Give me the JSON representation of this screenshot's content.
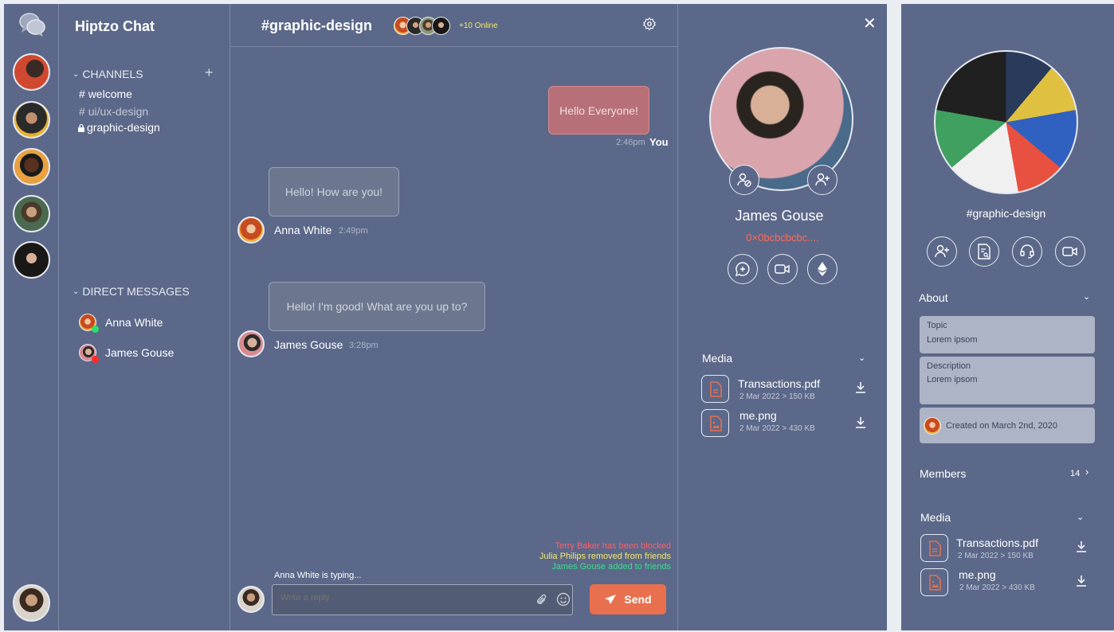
{
  "app_name": "Hiptzo Chat",
  "channels": {
    "header": "CHANNELS",
    "items": [
      {
        "prefix": "#",
        "label": "welcome"
      },
      {
        "prefix": "#",
        "label": "ui/ux-design"
      },
      {
        "prefix": "lock",
        "label": "graphic-design"
      }
    ]
  },
  "direct_messages": {
    "header": "DIRECT MESSAGES",
    "items": [
      {
        "label": "Anna White",
        "status_color": "#2ee06b"
      },
      {
        "label": "James Gouse",
        "status_color": "#ff2b2b"
      }
    ]
  },
  "chat": {
    "title": "#graphic-design",
    "online": "+10 Online",
    "messages": [
      {
        "text": "Hello Everyone!",
        "time": "2:46pm",
        "author": "You"
      },
      {
        "text": "Hello! How are you!",
        "author": "Anna White",
        "time": "2:49pm"
      },
      {
        "text": "Hello! I'm good! What are you up to?",
        "author": "James Gouse",
        "time": "3:28pm"
      }
    ],
    "notifications": [
      {
        "text": "Terry Baker has been blocked",
        "color": "#ff5f6b"
      },
      {
        "text": "Julia Philips removed from friends",
        "color": "#f4e96a"
      },
      {
        "text": "James Gouse added to friends",
        "color": "#38e08a"
      }
    ],
    "typing": "Anna White is typing...",
    "reply_placeholder": "Write a reply",
    "send_label": "Send"
  },
  "profile": {
    "name": "James Gouse",
    "address": "0×0bcbcbcbc....",
    "media_label": "Media",
    "files": [
      {
        "name": "Transactions.pdf",
        "meta": "2 Mar 2022 > 150 KB",
        "kind": "pdf"
      },
      {
        "name": "me.png",
        "meta": "2 Mar 2022 > 430 KB",
        "kind": "image"
      }
    ]
  },
  "channel_info": {
    "name": "#graphic-design",
    "about_label": "About",
    "topic_label": "Topic",
    "topic_value": "Lorem ipsom",
    "description_label": "Description",
    "description_value": "Lorem ipsom",
    "created": "Created on March 2nd, 2020",
    "members_label": "Members",
    "members_count": "14",
    "media_label": "Media",
    "files": [
      {
        "name": "Transactions.pdf",
        "meta": "2 Mar 2022 > 150 KB",
        "kind": "pdf"
      },
      {
        "name": "me.png",
        "meta": "2 Mar 2022 > 430 KB",
        "kind": "image"
      }
    ]
  },
  "colors": {
    "background": "#5b6889",
    "accent": "#e8704f",
    "own_bubble": "#b87078",
    "online_text": "#f4e96a",
    "address": "#ff6b5a"
  }
}
